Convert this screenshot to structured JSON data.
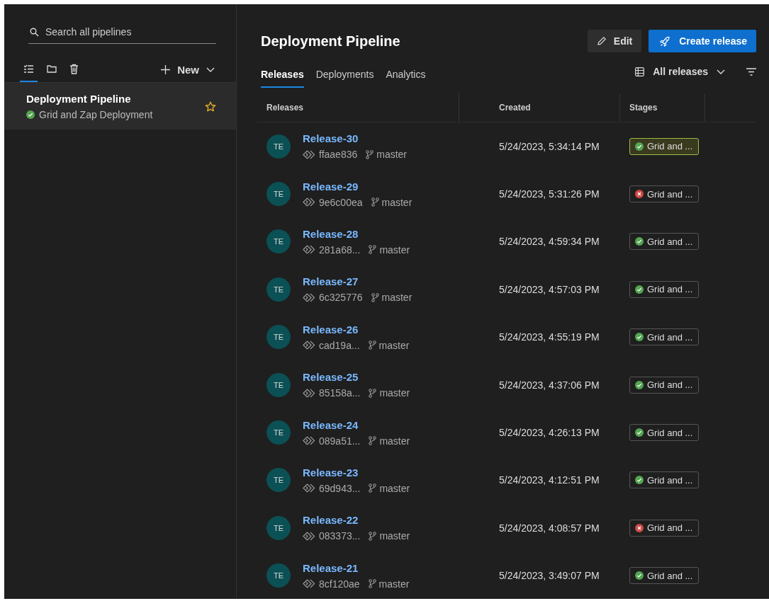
{
  "sidebar": {
    "search": {
      "placeholder": "Search all pipelines"
    },
    "view_tabs": [
      {
        "selected": true
      },
      {
        "selected": false
      },
      {
        "selected": false
      }
    ],
    "new_button": "New",
    "pipelines": [
      {
        "name": "Deployment Pipeline",
        "succeeded": true,
        "subtitle": "Grid and Zap Deployment",
        "favorite": true,
        "selected": true
      }
    ]
  },
  "header": {
    "title": "Deployment Pipeline",
    "edit_button": "Edit",
    "create_button": "Create release"
  },
  "tabs": [
    {
      "label": "Releases",
      "selected": true
    },
    {
      "label": "Deployments",
      "selected": false
    },
    {
      "label": "Analytics",
      "selected": false
    }
  ],
  "view_filter": "All releases",
  "table": {
    "columns": [
      "Releases",
      "Created",
      "Stages"
    ],
    "rows": [
      {
        "avatar": "TE",
        "name": "Release-30",
        "commit": "ffaae836",
        "branch": "master",
        "created": "5/24/2023, 5:34:14 PM",
        "stage": "Grid and ...",
        "stage_succeeded": true,
        "selected": true
      },
      {
        "avatar": "TE",
        "name": "Release-29",
        "commit": "9e6c00ea",
        "branch": "master",
        "created": "5/24/2023, 5:31:26 PM",
        "stage": "Grid and ...",
        "stage_succeeded": false,
        "selected": false
      },
      {
        "avatar": "TE",
        "name": "Release-28",
        "commit": "281a68...",
        "branch": "master",
        "created": "5/24/2023, 4:59:34 PM",
        "stage": "Grid and ...",
        "stage_succeeded": true,
        "selected": false
      },
      {
        "avatar": "TE",
        "name": "Release-27",
        "commit": "6c325776",
        "branch": "master",
        "created": "5/24/2023, 4:57:03 PM",
        "stage": "Grid and ...",
        "stage_succeeded": true,
        "selected": false
      },
      {
        "avatar": "TE",
        "name": "Release-26",
        "commit": "cad19a...",
        "branch": "master",
        "created": "5/24/2023, 4:55:19 PM",
        "stage": "Grid and ...",
        "stage_succeeded": true,
        "selected": false
      },
      {
        "avatar": "TE",
        "name": "Release-25",
        "commit": "85158a...",
        "branch": "master",
        "created": "5/24/2023, 4:37:06 PM",
        "stage": "Grid and ...",
        "stage_succeeded": true,
        "selected": false
      },
      {
        "avatar": "TE",
        "name": "Release-24",
        "commit": "089a51...",
        "branch": "master",
        "created": "5/24/2023, 4:26:13 PM",
        "stage": "Grid and ...",
        "stage_succeeded": true,
        "selected": false
      },
      {
        "avatar": "TE",
        "name": "Release-23",
        "commit": "69d943...",
        "branch": "master",
        "created": "5/24/2023, 4:12:51 PM",
        "stage": "Grid and ...",
        "stage_succeeded": true,
        "selected": false
      },
      {
        "avatar": "TE",
        "name": "Release-22",
        "commit": "083373...",
        "branch": "master",
        "created": "5/24/2023, 4:08:57 PM",
        "stage": "Grid and ...",
        "stage_succeeded": false,
        "selected": false
      },
      {
        "avatar": "TE",
        "name": "Release-21",
        "commit": "8cf120ae",
        "branch": "master",
        "created": "5/24/2023, 3:49:07 PM",
        "stage": "Grid and ...",
        "stage_succeeded": true,
        "selected": false
      }
    ]
  }
}
